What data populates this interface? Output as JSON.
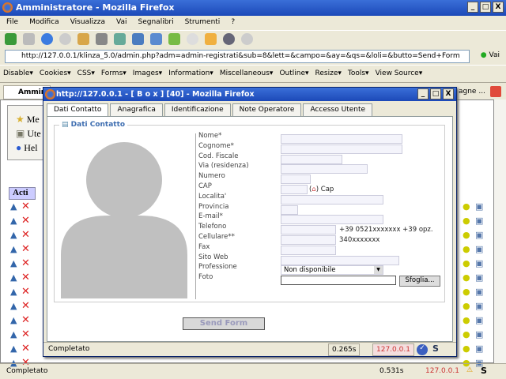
{
  "window": {
    "title": "Amministratore - Mozilla Firefox",
    "minimize": "_",
    "maximize": "□",
    "close": "X"
  },
  "menu": [
    "File",
    "Modifica",
    "Visualizza",
    "Vai",
    "Segnalibri",
    "Strumenti",
    "?"
  ],
  "address": {
    "url": "http://127.0.0.1/klinza_5.0/admin.php?adm=admin-registrati&sub=8&lett=&campo=&ay=&qs=&loli=&butto=Send+Form",
    "go": "Vai"
  },
  "devbar": [
    "Disable▾",
    "Cookies▾",
    "CSS▾",
    "Forms▾",
    "Images▾",
    "Information▾",
    "Miscellaneous▾",
    "Outline▾",
    "Resize▾",
    "Tools▾",
    "View Source▾"
  ],
  "tabs": {
    "left": "Ammini",
    "right": "agne ..."
  },
  "page": {
    "side": [
      "Me",
      "Ute",
      "Hel"
    ],
    "table_header": "Acti"
  },
  "popup": {
    "title": "http://127.0.0.1 - [ B o x ] [40] - Mozilla Firefox",
    "tabs": [
      "Dati Contatto",
      "Anagrafica",
      "Identificazione",
      "Note Operatore",
      "Accesso Utente"
    ],
    "legend": "Dati Contatto",
    "fields": [
      {
        "label": "Nome*",
        "value": ""
      },
      {
        "label": "Cognome*",
        "value": ""
      },
      {
        "label": "Cod. Fiscale",
        "value": ""
      },
      {
        "label": "Via (residenza)",
        "value": ""
      },
      {
        "label": "Numero",
        "value": ""
      },
      {
        "label": "CAP",
        "value": "",
        "hint": ") Cap",
        "hint_open": "("
      },
      {
        "label": "Localita'",
        "value": ""
      },
      {
        "label": "Provincia",
        "value": ""
      },
      {
        "label": "E-mail*",
        "value": ""
      },
      {
        "label": "Telefono",
        "value": "",
        "hint": "+39 0521xxxxxxx +39 opz."
      },
      {
        "label": "Cellulare**",
        "value": "",
        "hint": "340xxxxxxx"
      },
      {
        "label": "Fax",
        "value": ""
      },
      {
        "label": "Sito Web",
        "value": ""
      },
      {
        "label": "Professione",
        "value": "Non disponibile"
      },
      {
        "label": "Foto",
        "value": ""
      }
    ],
    "browse": "Sfoglia...",
    "send": "Send Form",
    "status": "Completato",
    "time": "0.265s",
    "ip": "127.0.0.1",
    "s": "S"
  },
  "status": {
    "text": "Completato",
    "time": "0.531s",
    "ip": "127.0.0.1",
    "s": "S"
  }
}
